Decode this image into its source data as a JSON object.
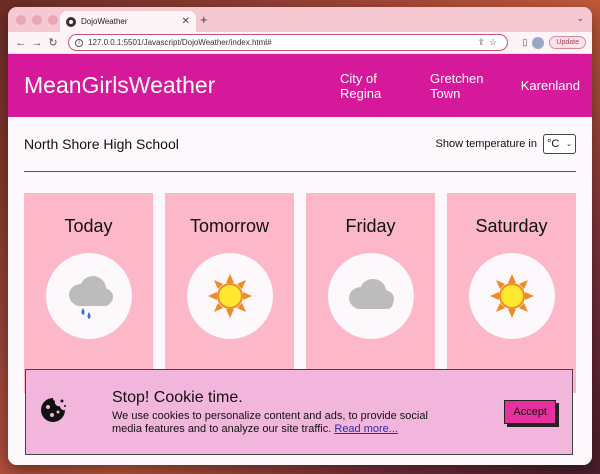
{
  "browser": {
    "tab_title": "DojoWeather",
    "tab_close": "✕",
    "new_tab": "+",
    "url": "127.0.0.1:5501/Javascript/DojoWeather/index.html#",
    "update_label": "Update"
  },
  "site": {
    "brand": "MeanGirlsWeather",
    "nav": [
      {
        "label": "City of Regina"
      },
      {
        "label": "Gretchen Town"
      },
      {
        "label": "Karenland"
      }
    ]
  },
  "location": {
    "title": "North Shore High School",
    "temp_label": "Show temperature in",
    "temp_unit": "°C"
  },
  "forecast": [
    {
      "day": "Today",
      "icon": "rain-cloud-icon"
    },
    {
      "day": "Tomorrow",
      "icon": "sun-icon"
    },
    {
      "day": "Friday",
      "icon": "cloud-icon"
    },
    {
      "day": "Saturday",
      "icon": "sun-icon"
    }
  ],
  "cookie": {
    "title": "Stop! Cookie time.",
    "body": "We use cookies to personalize content and ads, to provide social media features and to analyze our site traffic.",
    "link": "Read more...",
    "accept": "Accept"
  },
  "colors": {
    "header": "#d6199a",
    "card": "#fcb8c8",
    "cookie_banner": "#f2b6dd",
    "accept_button": "#e8309e"
  }
}
